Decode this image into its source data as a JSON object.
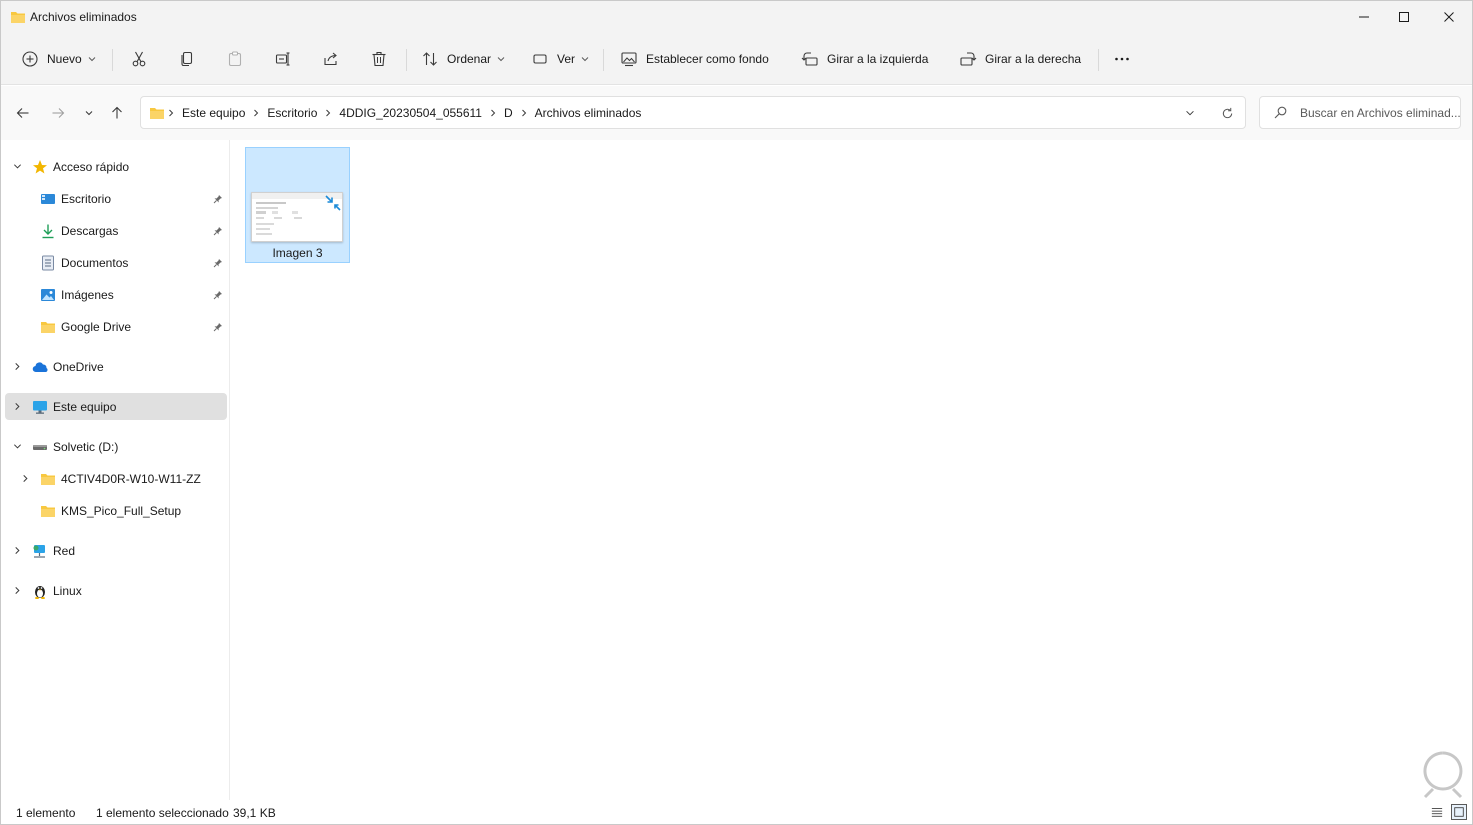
{
  "window": {
    "title": "Archivos eliminados"
  },
  "toolbar": {
    "new_label": "Nuevo",
    "sort_label": "Ordenar",
    "view_label": "Ver",
    "set_background_label": "Establecer como fondo",
    "rotate_left_label": "Girar a la izquierda",
    "rotate_right_label": "Girar a la derecha"
  },
  "address": {
    "breadcrumbs": [
      "Este equipo",
      "Escritorio",
      "4DDIG_20230504_055611",
      "D",
      "Archivos eliminados"
    ],
    "search_placeholder": "Buscar en Archivos eliminad..."
  },
  "sidebar": {
    "quick_access": "Acceso rápido",
    "items": [
      {
        "label": "Escritorio",
        "icon": "desktop-icon",
        "pinned": true
      },
      {
        "label": "Descargas",
        "icon": "download-icon",
        "pinned": true
      },
      {
        "label": "Documentos",
        "icon": "document-icon",
        "pinned": true
      },
      {
        "label": "Imágenes",
        "icon": "pictures-icon",
        "pinned": true
      },
      {
        "label": "Google Drive",
        "icon": "folder-icon",
        "pinned": true
      }
    ],
    "onedrive": "OneDrive",
    "this_pc": "Este equipo",
    "drive": "Solvetic (D:)",
    "drive_children": [
      "4CTIV4D0R-W10-W11-ZZ",
      "KMS_Pico_Full_Setup"
    ],
    "network": "Red",
    "linux": "Linux"
  },
  "content": {
    "files": [
      {
        "name": "Imagen 3",
        "selected": true
      }
    ]
  },
  "status": {
    "item_count": "1 elemento",
    "selection": "1 elemento seleccionado",
    "size": "39,1 KB"
  },
  "colors": {
    "selection_bg": "#cce8ff",
    "selection_border": "#99d1ff",
    "folder_yellow": "#f8c840",
    "accent_blue": "#0078d4"
  }
}
